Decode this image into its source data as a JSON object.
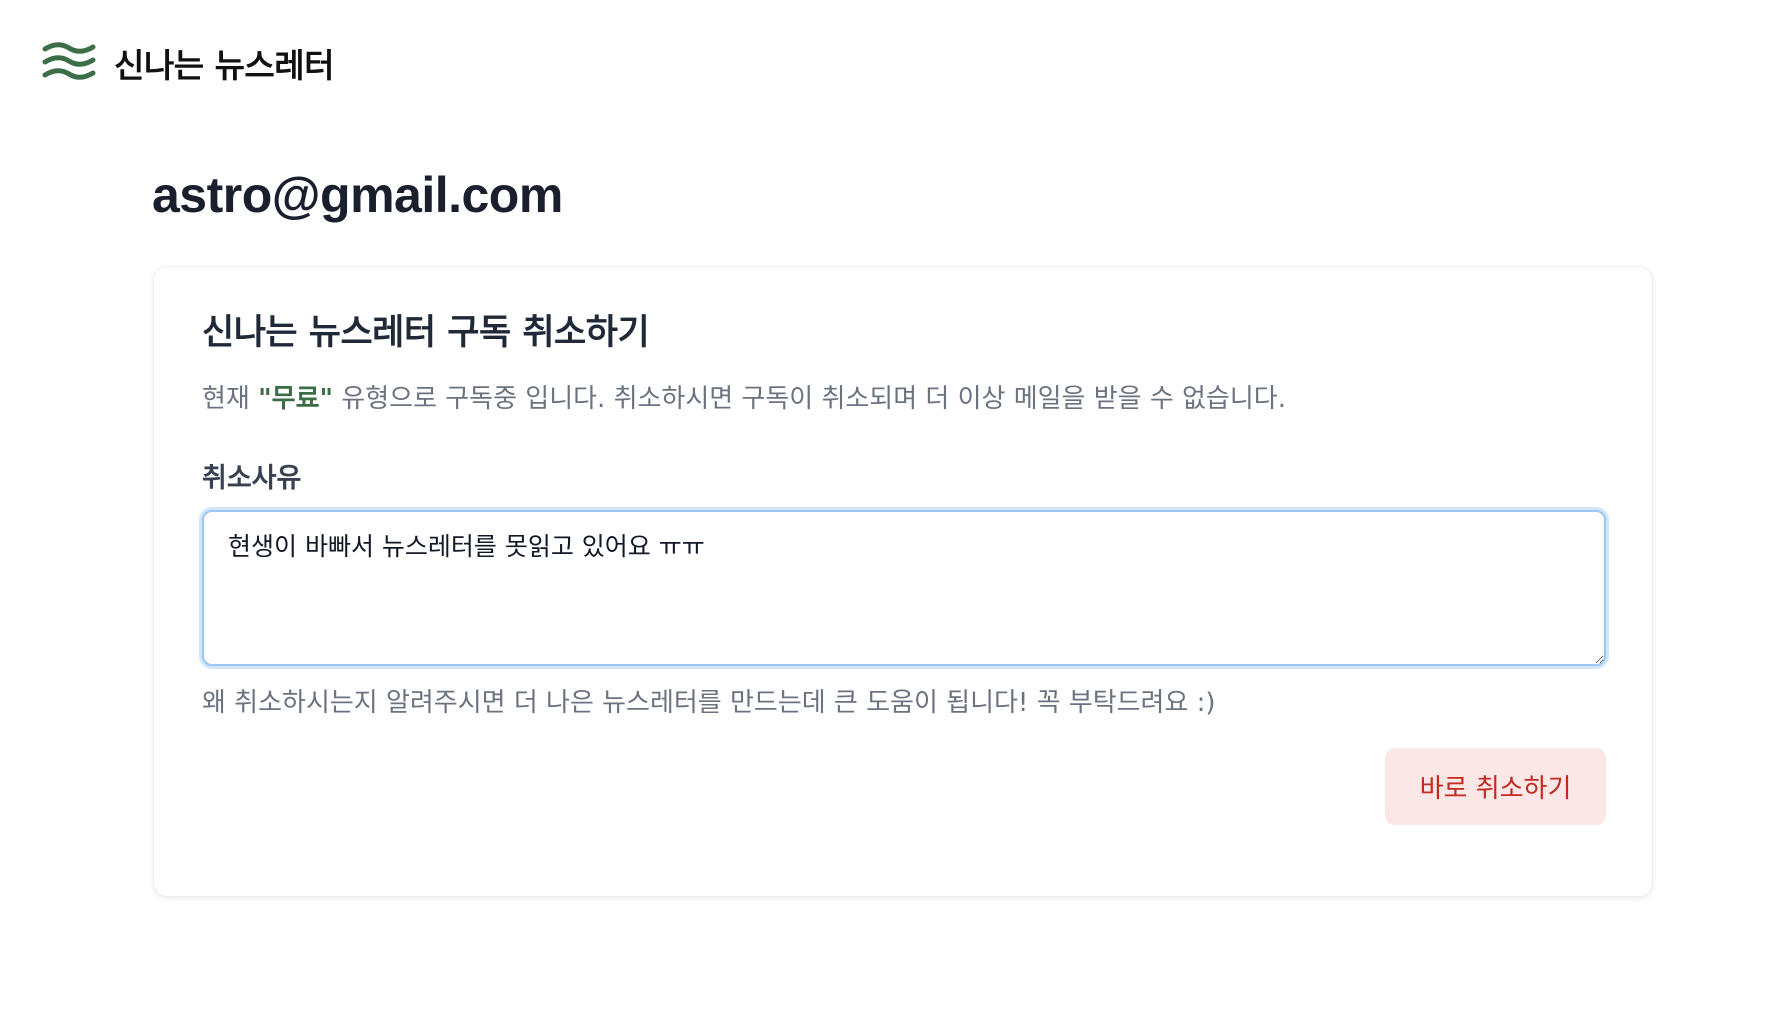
{
  "header": {
    "brand": "신나는 뉴스레터",
    "logo_icon": "waves-icon",
    "logo_color": "#3b6e47"
  },
  "user": {
    "email": "astro@gmail.com"
  },
  "card": {
    "title": "신나는 뉴스레터 구독 취소하기",
    "desc_prefix": "현재 ",
    "plan": "\"무료\"",
    "desc_suffix": " 유형으로 구독중 입니다. 취소하시면 구독이 취소되며 더 이상 메일을 받을 수 없습니다.",
    "reason_label": "취소사유",
    "reason_value": "현생이 바빠서 뉴스레터를 못읽고 있어요 ㅠㅠ",
    "helper_text": "왜 취소하시는지 알려주시면 더 나은 뉴스레터를 만드는데 큰 도움이 됩니다! 꼭 부탁드려요 :)",
    "cancel_button": "바로 취소하기"
  },
  "colors": {
    "accent_green": "#3b6e47",
    "danger_text": "#c4281e",
    "danger_bg": "#fbe7e6",
    "focus_ring": "#9ec5f0"
  }
}
